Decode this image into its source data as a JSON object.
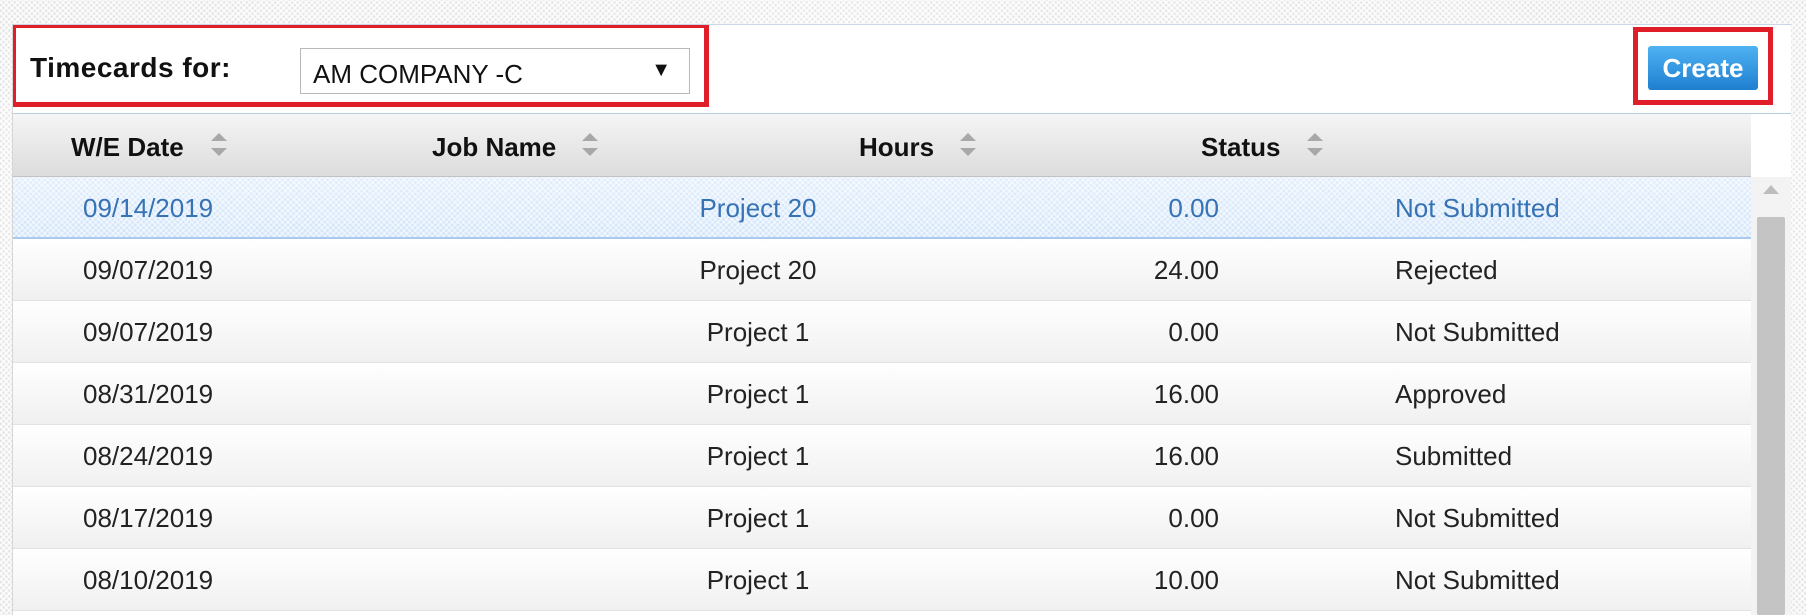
{
  "toolbar": {
    "label": "Timecards for:",
    "company_selected": "AM COMPANY -C",
    "create_label": "Create"
  },
  "table": {
    "columns": [
      "W/E Date",
      "Job Name",
      "Hours",
      "Status"
    ],
    "rows": [
      {
        "date": "09/14/2019",
        "job": "Project 20",
        "hours": "0.00",
        "status": "Not Submitted",
        "selected": true
      },
      {
        "date": "09/07/2019",
        "job": "Project 20",
        "hours": "24.00",
        "status": "Rejected"
      },
      {
        "date": "09/07/2019",
        "job": "Project 1",
        "hours": "0.00",
        "status": "Not Submitted"
      },
      {
        "date": "08/31/2019",
        "job": "Project 1",
        "hours": "16.00",
        "status": "Approved"
      },
      {
        "date": "08/24/2019",
        "job": "Project 1",
        "hours": "16.00",
        "status": "Submitted"
      },
      {
        "date": "08/17/2019",
        "job": "Project 1",
        "hours": "0.00",
        "status": "Not Submitted"
      },
      {
        "date": "08/10/2019",
        "job": "Project 1",
        "hours": "10.00",
        "status": "Not Submitted"
      }
    ]
  },
  "colors": {
    "highlight_border": "#e01e2a",
    "selected_row": "#cfe3fa",
    "selected_text": "#3672b4",
    "create_button": "#1f7fd0"
  },
  "icons": {
    "sort": "sort-arrows-icon",
    "dropdown": "chevron-down-icon",
    "scroll_up": "scroll-up-icon"
  }
}
